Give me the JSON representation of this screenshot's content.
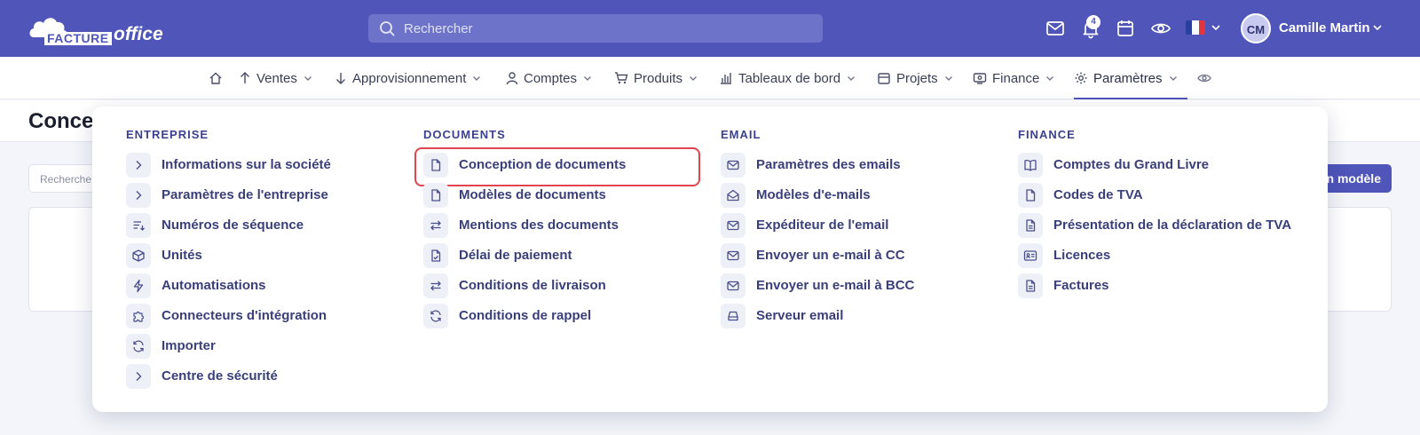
{
  "brand": {
    "logo_word1": "FACTURE",
    "logo_word2": "office"
  },
  "topbar": {
    "search_placeholder": "Rechercher",
    "notification_count": "4",
    "user_initials": "CM",
    "user_name": "Camille Martin",
    "bg_color": "#4f55b9"
  },
  "nav": {
    "items": [
      {
        "label": "Ventes"
      },
      {
        "label": "Approvisionnement"
      },
      {
        "label": "Comptes"
      },
      {
        "label": "Produits"
      },
      {
        "label": "Tableaux de bord"
      },
      {
        "label": "Projets"
      },
      {
        "label": "Finance"
      },
      {
        "label": "Paramètres",
        "active": true
      }
    ]
  },
  "page": {
    "title": "Conce",
    "search_placeholder": "Recherche",
    "new_button": "n modèle"
  },
  "menu": {
    "columns": [
      {
        "heading": "ENTREPRISE",
        "items": [
          {
            "label": "Informations sur la société",
            "icon": "chevron-right-icon"
          },
          {
            "label": "Paramètres de l'entreprise",
            "icon": "chevron-right-icon"
          },
          {
            "label": "Numéros de séquence",
            "icon": "sort-list-icon"
          },
          {
            "label": "Unités",
            "icon": "box-icon"
          },
          {
            "label": "Automatisations",
            "icon": "lightning-icon"
          },
          {
            "label": "Connecteurs d'intégration",
            "icon": "puzzle-icon"
          },
          {
            "label": "Importer",
            "icon": "refresh-icon"
          },
          {
            "label": "Centre de sécurité",
            "icon": "chevron-right-icon"
          }
        ]
      },
      {
        "heading": "DOCUMENTS",
        "items": [
          {
            "label": "Conception de documents",
            "icon": "document-icon",
            "highlighted": true
          },
          {
            "label": "Modèles de documents",
            "icon": "document-icon"
          },
          {
            "label": "Mentions des documents",
            "icon": "swap-icon"
          },
          {
            "label": "Délai de paiement",
            "icon": "document-check-icon"
          },
          {
            "label": "Conditions de livraison",
            "icon": "swap-icon"
          },
          {
            "label": "Conditions de rappel",
            "icon": "refresh-icon"
          }
        ]
      },
      {
        "heading": "EMAIL",
        "items": [
          {
            "label": "Paramètres des emails",
            "icon": "mail-icon"
          },
          {
            "label": "Modèles d'e-mails",
            "icon": "mail-open-icon"
          },
          {
            "label": "Expéditeur de l'email",
            "icon": "mail-icon"
          },
          {
            "label": "Envoyer un e-mail à CC",
            "icon": "mail-icon"
          },
          {
            "label": "Envoyer un e-mail à BCC",
            "icon": "mail-icon"
          },
          {
            "label": "Serveur email",
            "icon": "server-icon"
          }
        ]
      },
      {
        "heading": "FINANCE",
        "items": [
          {
            "label": "Comptes du Grand Livre",
            "icon": "book-icon"
          },
          {
            "label": "Codes de TVA",
            "icon": "document-icon"
          },
          {
            "label": "Présentation de la déclaration de TVA",
            "icon": "document-lines-icon"
          },
          {
            "label": "Licences",
            "icon": "id-card-icon"
          },
          {
            "label": "Factures",
            "icon": "document-lines-icon"
          }
        ]
      }
    ]
  }
}
